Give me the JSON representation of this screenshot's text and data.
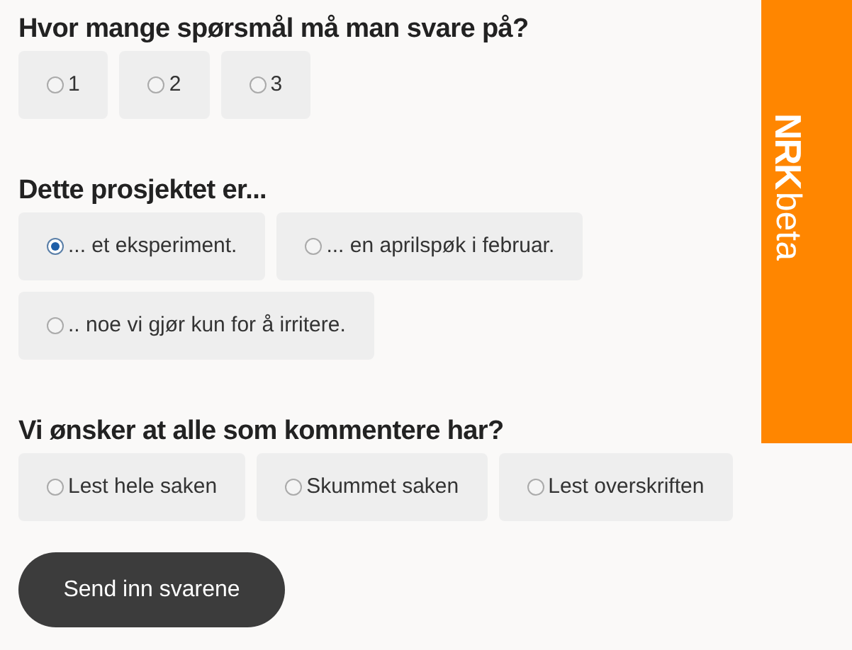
{
  "questions": [
    {
      "title": "Hvor mange spørsmål må man svare på?",
      "options": [
        {
          "label": "1",
          "selected": false
        },
        {
          "label": "2",
          "selected": false
        },
        {
          "label": "3",
          "selected": false
        }
      ]
    },
    {
      "title": "Dette prosjektet er...",
      "options": [
        {
          "label": "... et eksperiment.",
          "selected": true
        },
        {
          "label": "... en aprilspøk i februar.",
          "selected": false
        },
        {
          "label": ".. noe vi gjør kun for å irritere.",
          "selected": false
        }
      ]
    },
    {
      "title": "Vi ønsker at alle som kommentere har?",
      "options": [
        {
          "label": "Lest hele saken",
          "selected": false
        },
        {
          "label": "Skummet saken",
          "selected": false
        },
        {
          "label": "Lest overskriften",
          "selected": false
        }
      ]
    }
  ],
  "submit": "Send inn svarene",
  "logo": {
    "brand": "NRK",
    "suffix": "beta"
  }
}
